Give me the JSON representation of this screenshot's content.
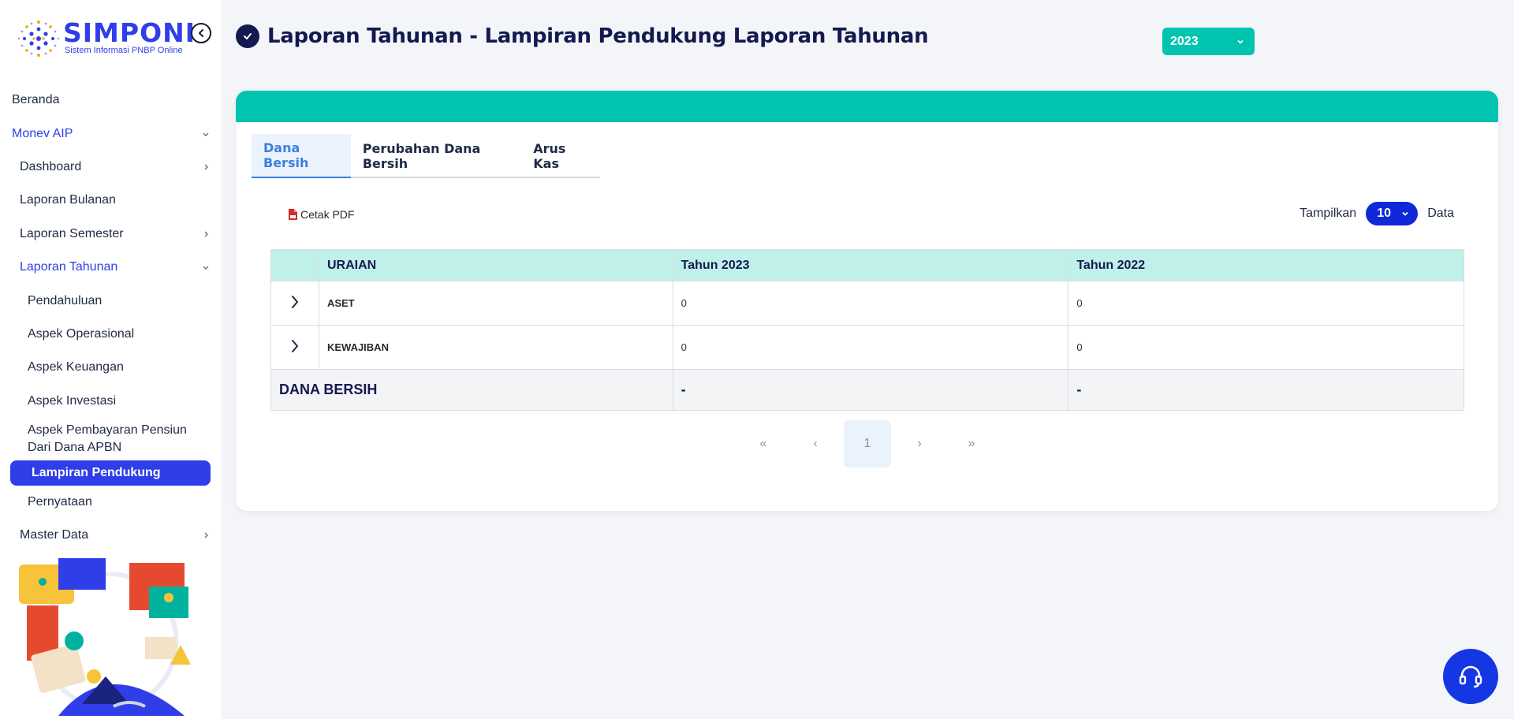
{
  "brand": {
    "name": "SIMPONI",
    "subtitle": "Sistem Informasi PNBP Online"
  },
  "sidebar": {
    "items": [
      {
        "label": "Beranda"
      },
      {
        "label": "Monev AIP"
      },
      {
        "label": "Dashboard"
      },
      {
        "label": "Laporan Bulanan"
      },
      {
        "label": "Laporan Semester"
      },
      {
        "label": "Laporan Tahunan"
      },
      {
        "label": "Pendahuluan"
      },
      {
        "label": "Aspek Operasional"
      },
      {
        "label": "Aspek Keuangan"
      },
      {
        "label": "Aspek Investasi"
      },
      {
        "label": "Aspek Pembayaran Pensiun Dari Dana APBN"
      },
      {
        "label": "Lampiran Pendukung"
      },
      {
        "label": "Pernyataan"
      },
      {
        "label": "Master Data"
      }
    ]
  },
  "header": {
    "title": "Laporan Tahunan - Lampiran Pendukung Laporan Tahunan",
    "year": "2023"
  },
  "tabs": [
    {
      "label": "Dana Bersih"
    },
    {
      "label": "Perubahan Dana Bersih"
    },
    {
      "label": "Arus Kas"
    }
  ],
  "toolbar": {
    "pdf_label": "Cetak PDF",
    "show_label": "Tampilkan",
    "page_size": "10",
    "data_label": "Data"
  },
  "table": {
    "headers": [
      "URAIAN",
      "Tahun 2023",
      "Tahun 2022"
    ],
    "rows": [
      {
        "label": "ASET",
        "y2023": "0",
        "y2022": "0"
      },
      {
        "label": "KEWAJIBAN",
        "y2023": "0",
        "y2022": "0"
      }
    ],
    "total": {
      "label": "DANA BERSIH",
      "y2023": "-",
      "y2022": "-"
    }
  },
  "pagination": {
    "first": "«",
    "prev": "‹",
    "current": "1",
    "next": "›",
    "last": "»"
  },
  "colors": {
    "accent": "#2f3ee8",
    "teal": "#00c4b0",
    "navy": "#141a4f"
  }
}
